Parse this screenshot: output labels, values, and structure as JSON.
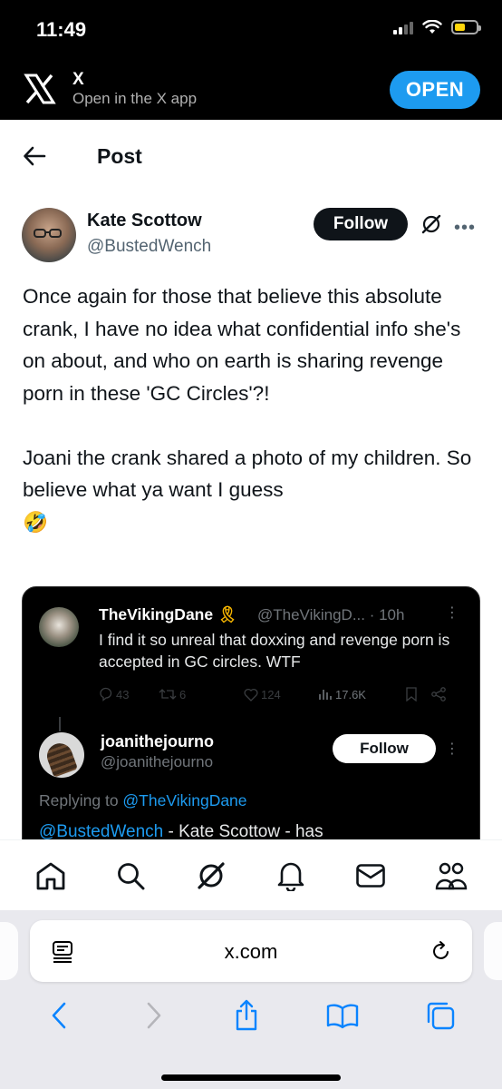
{
  "status_bar": {
    "time": "11:49"
  },
  "app_banner": {
    "title": "X",
    "subtitle": "Open in the X app",
    "open_label": "OPEN"
  },
  "header": {
    "title": "Post"
  },
  "author": {
    "name": "Kate Scottow",
    "handle": "@BustedWench",
    "follow_label": "Follow"
  },
  "tweet": {
    "text": "Once again for those that believe this absolute crank, I have no idea what confidential info she's on about, and who on earth is sharing revenge porn in these 'GC Circles'?!\n\nJoani the crank shared a photo of my children. So believe what ya want I guess\n🤣"
  },
  "embedded": {
    "quoted": {
      "name": "TheVikingDane",
      "ribbon": "🎗",
      "handle_time": "@TheVikingD... · 10h",
      "text": "I find it so unreal that doxxing and revenge porn is accepted in GC circles. WTF",
      "replies": "43",
      "retweets": "6",
      "likes": "124",
      "views": "17.6K"
    },
    "reply": {
      "name": "joanithejourno",
      "handle": "@joanithejourno",
      "follow_label": "Follow",
      "replying_prefix": "Replying to ",
      "replying_to": "@TheVikingDane",
      "cut_mention": "@BustedWench",
      "cut_text": " - Kate Scottow - has"
    }
  },
  "tabbar": {
    "items": [
      "home-icon",
      "search-icon",
      "grok-icon",
      "notifications-icon",
      "messages-icon",
      "communities-icon"
    ]
  },
  "browser": {
    "url": "x.com"
  },
  "colors": {
    "accent": "#1d9bf0",
    "text": "#0f1419",
    "muted": "#536471"
  }
}
